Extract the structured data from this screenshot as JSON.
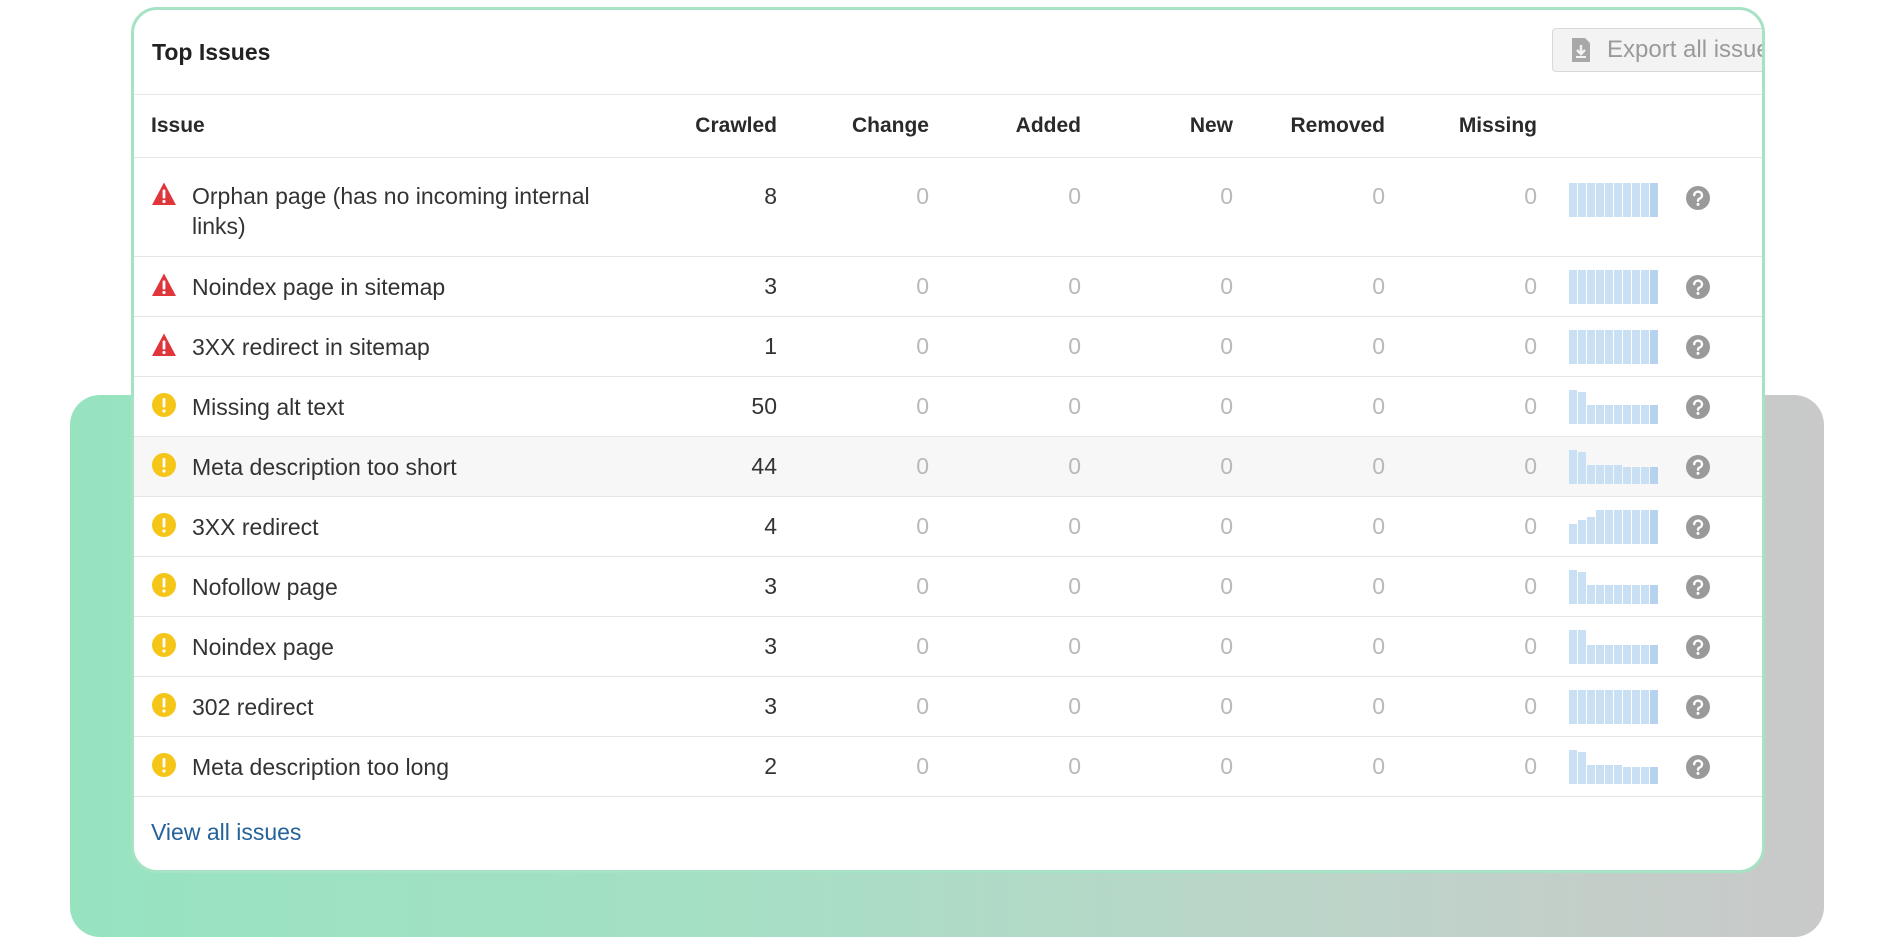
{
  "panel": {
    "title": "Top Issues",
    "export_label": "Export all issue"
  },
  "columns": {
    "issue": "Issue",
    "crawled": "Crawled",
    "change": "Change",
    "added": "Added",
    "new": "New",
    "removed": "Removed",
    "missing": "Missing"
  },
  "rows": [
    {
      "severity": "error",
      "label": "Orphan page (has no incoming internal links)",
      "crawled": "8",
      "change": "0",
      "added": "0",
      "new": "0",
      "removed": "0",
      "missing": "0",
      "trend": [
        1,
        1,
        1,
        1,
        1,
        1,
        1,
        1,
        1,
        1
      ]
    },
    {
      "severity": "error",
      "label": "Noindex page in sitemap",
      "crawled": "3",
      "change": "0",
      "added": "0",
      "new": "0",
      "removed": "0",
      "missing": "0",
      "trend": [
        1,
        1,
        1,
        1,
        1,
        1,
        1,
        1,
        1,
        1
      ]
    },
    {
      "severity": "error",
      "label": "3XX redirect in sitemap",
      "crawled": "1",
      "change": "0",
      "added": "0",
      "new": "0",
      "removed": "0",
      "missing": "0",
      "trend": [
        1,
        1,
        1,
        1,
        1,
        1,
        1,
        1,
        1,
        1
      ]
    },
    {
      "severity": "notice",
      "label": "Missing alt text",
      "crawled": "50",
      "change": "0",
      "added": "0",
      "new": "0",
      "removed": "0",
      "missing": "0",
      "trend": [
        1,
        0.95,
        0.55,
        0.55,
        0.55,
        0.55,
        0.55,
        0.55,
        0.55,
        0.55
      ]
    },
    {
      "severity": "notice",
      "label": "Meta description too short",
      "crawled": "44",
      "change": "0",
      "added": "0",
      "new": "0",
      "removed": "0",
      "missing": "0",
      "trend": [
        1,
        0.95,
        0.55,
        0.55,
        0.55,
        0.55,
        0.5,
        0.5,
        0.5,
        0.5
      ]
    },
    {
      "severity": "notice",
      "label": "3XX redirect",
      "crawled": "4",
      "change": "0",
      "added": "0",
      "new": "0",
      "removed": "0",
      "missing": "0",
      "trend": [
        0.6,
        0.7,
        0.8,
        1,
        1,
        1,
        1,
        1,
        1,
        1
      ]
    },
    {
      "severity": "notice",
      "label": "Nofollow page",
      "crawled": "3",
      "change": "0",
      "added": "0",
      "new": "0",
      "removed": "0",
      "missing": "0",
      "trend": [
        1,
        0.95,
        0.55,
        0.55,
        0.55,
        0.55,
        0.55,
        0.55,
        0.55,
        0.55
      ]
    },
    {
      "severity": "notice",
      "label": "Noindex page",
      "crawled": "3",
      "change": "0",
      "added": "0",
      "new": "0",
      "removed": "0",
      "missing": "0",
      "trend": [
        1,
        1,
        0.55,
        0.55,
        0.55,
        0.55,
        0.55,
        0.55,
        0.55,
        0.55
      ]
    },
    {
      "severity": "notice",
      "label": "302 redirect",
      "crawled": "3",
      "change": "0",
      "added": "0",
      "new": "0",
      "removed": "0",
      "missing": "0",
      "trend": [
        1,
        1,
        1,
        1,
        1,
        1,
        1,
        1,
        1,
        1
      ]
    },
    {
      "severity": "notice",
      "label": "Meta description too long",
      "crawled": "2",
      "change": "0",
      "added": "0",
      "new": "0",
      "removed": "0",
      "missing": "0",
      "trend": [
        1,
        0.95,
        0.55,
        0.55,
        0.55,
        0.55,
        0.5,
        0.5,
        0.5,
        0.5
      ]
    }
  ],
  "footer": {
    "view_all_label": "View all issues"
  },
  "colors": {
    "error": "#e0353b",
    "notice": "#f5c518",
    "link": "#24629a",
    "sparkline": "#c9dff3"
  },
  "icons": {
    "error": "warning-triangle-icon",
    "notice": "info-circle-icon",
    "help": "question-circle-icon",
    "export": "download-icon"
  }
}
